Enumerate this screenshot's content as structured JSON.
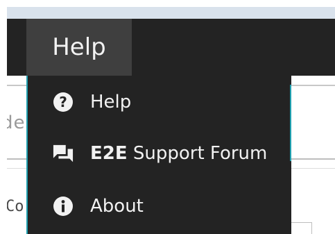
{
  "menubar": {
    "active_menu_label": "Help"
  },
  "background": {
    "partial_text_left": "des",
    "partial_text_lower": "Co"
  },
  "dropdown": {
    "items": [
      {
        "label": "Help",
        "icon": "question-circle-icon"
      },
      {
        "label_strong": "E2E",
        "label_rest": " Support Forum",
        "icon": "chat-bubbles-icon"
      },
      {
        "label": "About",
        "icon": "info-circle-icon"
      }
    ]
  },
  "colors": {
    "menubar_bg": "#232323",
    "active_tab_bg": "#3f3f3f",
    "accent_border": "#1fa0b0",
    "text_light": "#f2f2f2"
  }
}
